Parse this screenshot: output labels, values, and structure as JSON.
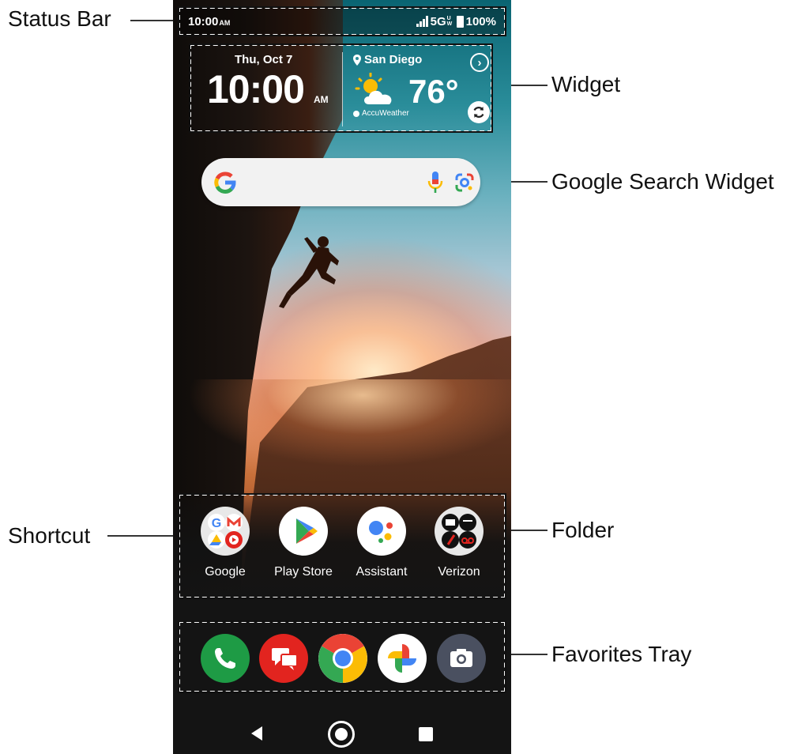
{
  "status_bar": {
    "time": "10:00",
    "time_suffix": "AM",
    "network": "5G",
    "network_sup": "UW",
    "battery": "100%"
  },
  "widget": {
    "date": "Thu, Oct 7",
    "time": "10:00",
    "ampm": "AM",
    "location": "San Diego",
    "temperature": "76°",
    "provider": "AccuWeather"
  },
  "apps": [
    {
      "label": "Google"
    },
    {
      "label": "Play Store"
    },
    {
      "label": "Assistant"
    },
    {
      "label": "Verizon"
    }
  ],
  "favorites": [
    "phone",
    "messages",
    "chrome",
    "photos",
    "camera"
  ],
  "callouts": {
    "status_bar": "Status Bar",
    "widget": "Widget",
    "google_search_widget": "Google Search Widget",
    "shortcut": "Shortcut",
    "folder": "Folder",
    "favorites_tray": "Favorites Tray"
  },
  "colors": {
    "phone_green": "#1e9b45",
    "messages_red": "#e2241f",
    "camera_gray": "#4a5060",
    "google_blue": "#4285f4",
    "google_red": "#ea4335",
    "google_yellow": "#fbbc05",
    "google_green": "#34a853"
  }
}
